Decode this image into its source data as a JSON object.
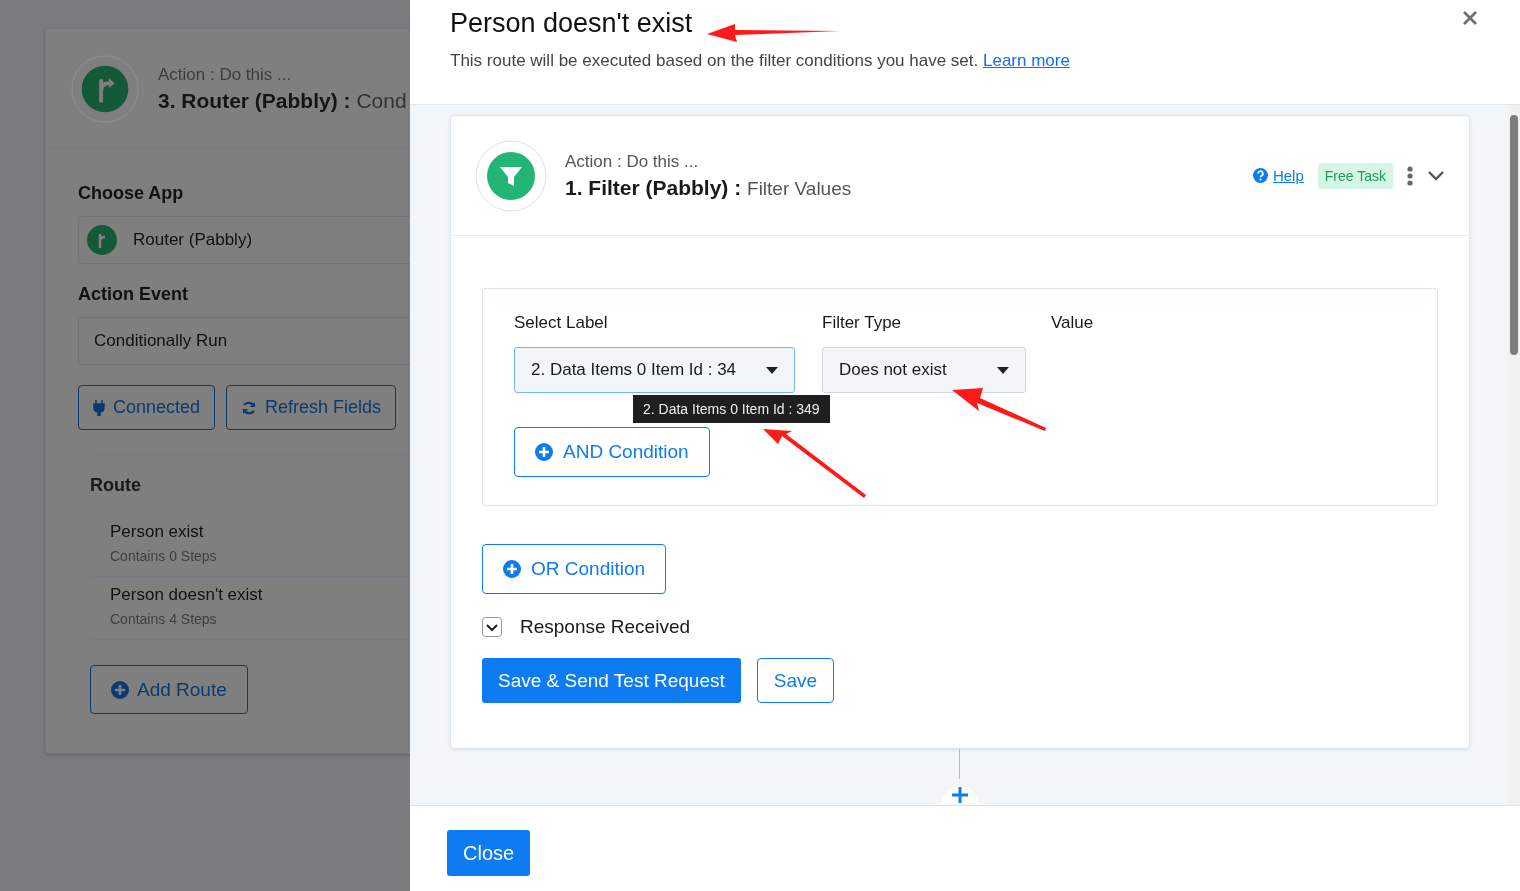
{
  "background_panel": {
    "step_caption": "Action : Do this ...",
    "step_title": "3. Router (Pabbly) :",
    "step_event": "Cond",
    "choose_app_label": "Choose App",
    "app": "Router (Pabbly)",
    "action_event_label": "Action Event",
    "action_event": "Conditionally Run",
    "connected_button": "Connected",
    "refresh_button": "Refresh Fields",
    "route_heading": "Route",
    "routes": [
      {
        "name": "Person exist",
        "steps": "Contains 0 Steps"
      },
      {
        "name": "Person doesn't exist",
        "steps": "Contains 4 Steps"
      }
    ],
    "add_route": "Add Route"
  },
  "modal": {
    "title": "Person doesn't exist",
    "description": "This route will be executed based on the filter conditions you have set.",
    "learn_more": "Learn more",
    "step": {
      "caption": "Action : Do this ...",
      "title": "1. Filter (Pabbly) :",
      "event": "Filter Values",
      "help": "Help",
      "badge": "Free Task"
    },
    "condition": {
      "label_heading": "Select Label",
      "type_heading": "Filter Type",
      "value_heading": "Value",
      "label_value": "2. Data Items 0 Item Id : 34",
      "type_value": "Does not exist",
      "tooltip": "2. Data Items 0 Item Id : 349"
    },
    "and_button": "AND Condition",
    "or_button": "OR Condition",
    "response_label": "Response Received",
    "save_send_button": "Save & Send Test Request",
    "save_button": "Save",
    "close_button": "Close"
  }
}
